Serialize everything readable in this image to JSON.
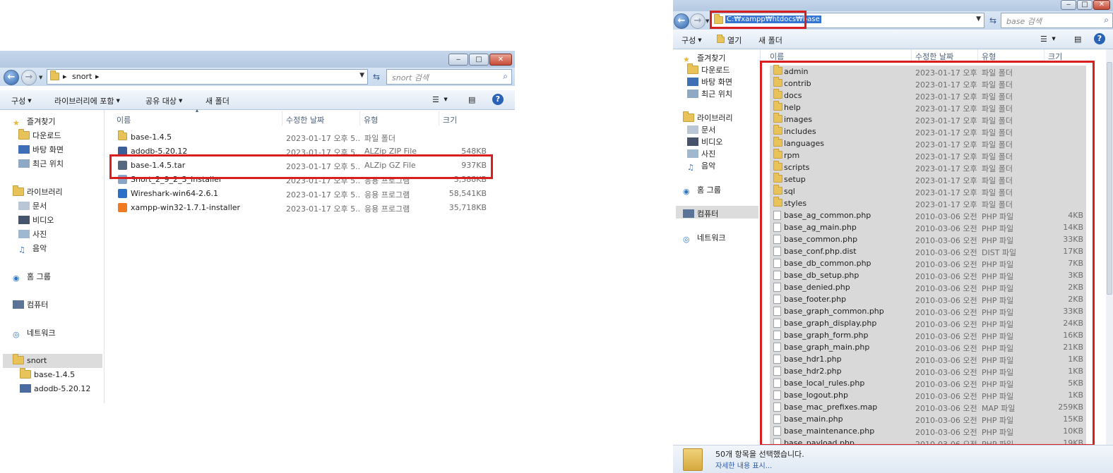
{
  "left": {
    "path": [
      "snort"
    ],
    "search_placeholder": "snort 검색",
    "toolbar": {
      "organize": "구성",
      "include_library": "라이브러리에 포함",
      "share": "공유 대상",
      "new_folder": "새 폴더"
    },
    "columns": {
      "name": "이름",
      "date": "수정한 날짜",
      "type": "유형",
      "size": "크기"
    },
    "nav": {
      "favorites": "즐겨찾기",
      "downloads": "다운로드",
      "desktop": "바탕 화면",
      "recent": "최근 위치",
      "libraries": "라이브러리",
      "documents": "문서",
      "videos": "비디오",
      "pictures": "사진",
      "music": "음악",
      "homegroup": "홈 그룹",
      "computer": "컴퓨터",
      "network": "네트워크",
      "snort": "snort",
      "base": "base-1.4.5",
      "adodb": "adodb-5.20.12"
    },
    "files": [
      {
        "name": "base-1.4.5",
        "date": "2023-01-17 오후 5...",
        "type": "파일 폴더",
        "size": "",
        "icon": "folder"
      },
      {
        "name": "adodb-5.20.12",
        "date": "2023-01-17 오후 5...",
        "type": "ALZip ZIP File",
        "size": "548KB",
        "icon": "zip"
      },
      {
        "name": "base-1.4.5.tar",
        "date": "2023-01-17 오후 5...",
        "type": "ALZip GZ File",
        "size": "937KB",
        "icon": "gz"
      },
      {
        "name": "Snort_2_9_2_3_Installer",
        "date": "2023-01-17 오후 5...",
        "type": "응용 프로그램",
        "size": "3,388KB",
        "icon": "app"
      },
      {
        "name": "Wireshark-win64-2.6.1",
        "date": "2023-01-17 오후 5...",
        "type": "응용 프로그램",
        "size": "58,541KB",
        "icon": "shark"
      },
      {
        "name": "xampp-win32-1.7.1-installer",
        "date": "2023-01-17 오후 5...",
        "type": "응용 프로그램",
        "size": "35,718KB",
        "icon": "xampp"
      }
    ]
  },
  "right": {
    "path": "C:₩xampp₩htdocs₩base",
    "search_placeholder": "base 검색",
    "toolbar": {
      "organize": "구성",
      "open": "열기",
      "new_folder": "새 폴더"
    },
    "columns": {
      "name": "이름",
      "date": "수정한 날짜",
      "type": "유형",
      "size": "크기"
    },
    "nav": {
      "favorites": "즐겨찾기",
      "downloads": "다운로드",
      "desktop": "바탕 화면",
      "recent": "최근 위치",
      "libraries": "라이브러리",
      "documents": "문서",
      "videos": "비디오",
      "pictures": "사진",
      "music": "음악",
      "homegroup": "홈 그룹",
      "computer": "컴퓨터",
      "network": "네트워크"
    },
    "files": [
      {
        "name": "admin",
        "date": "2023-01-17 오후 5...",
        "type": "파일 폴더",
        "size": "",
        "icon": "folder"
      },
      {
        "name": "contrib",
        "date": "2023-01-17 오후 5...",
        "type": "파일 폴더",
        "size": "",
        "icon": "folder"
      },
      {
        "name": "docs",
        "date": "2023-01-17 오후 5...",
        "type": "파일 폴더",
        "size": "",
        "icon": "folder"
      },
      {
        "name": "help",
        "date": "2023-01-17 오후 5...",
        "type": "파일 폴더",
        "size": "",
        "icon": "folder"
      },
      {
        "name": "images",
        "date": "2023-01-17 오후 5...",
        "type": "파일 폴더",
        "size": "",
        "icon": "folder"
      },
      {
        "name": "includes",
        "date": "2023-01-17 오후 5...",
        "type": "파일 폴더",
        "size": "",
        "icon": "folder"
      },
      {
        "name": "languages",
        "date": "2023-01-17 오후 5...",
        "type": "파일 폴더",
        "size": "",
        "icon": "folder"
      },
      {
        "name": "rpm",
        "date": "2023-01-17 오후 5...",
        "type": "파일 폴더",
        "size": "",
        "icon": "folder"
      },
      {
        "name": "scripts",
        "date": "2023-01-17 오후 5...",
        "type": "파일 폴더",
        "size": "",
        "icon": "folder"
      },
      {
        "name": "setup",
        "date": "2023-01-17 오후 5...",
        "type": "파일 폴더",
        "size": "",
        "icon": "folder"
      },
      {
        "name": "sql",
        "date": "2023-01-17 오후 5...",
        "type": "파일 폴더",
        "size": "",
        "icon": "folder"
      },
      {
        "name": "styles",
        "date": "2023-01-17 오후 5...",
        "type": "파일 폴더",
        "size": "",
        "icon": "folder"
      },
      {
        "name": "base_ag_common.php",
        "date": "2010-03-06 오전 1...",
        "type": "PHP 파일",
        "size": "4KB",
        "icon": "file"
      },
      {
        "name": "base_ag_main.php",
        "date": "2010-03-06 오전 1...",
        "type": "PHP 파일",
        "size": "14KB",
        "icon": "file"
      },
      {
        "name": "base_common.php",
        "date": "2010-03-06 오전 1...",
        "type": "PHP 파일",
        "size": "33KB",
        "icon": "file"
      },
      {
        "name": "base_conf.php.dist",
        "date": "2010-03-06 오전 1...",
        "type": "DIST 파일",
        "size": "17KB",
        "icon": "file"
      },
      {
        "name": "base_db_common.php",
        "date": "2010-03-06 오전 1...",
        "type": "PHP 파일",
        "size": "7KB",
        "icon": "file"
      },
      {
        "name": "base_db_setup.php",
        "date": "2010-03-06 오전 1...",
        "type": "PHP 파일",
        "size": "3KB",
        "icon": "file"
      },
      {
        "name": "base_denied.php",
        "date": "2010-03-06 오전 1...",
        "type": "PHP 파일",
        "size": "2KB",
        "icon": "file"
      },
      {
        "name": "base_footer.php",
        "date": "2010-03-06 오전 1...",
        "type": "PHP 파일",
        "size": "2KB",
        "icon": "file"
      },
      {
        "name": "base_graph_common.php",
        "date": "2010-03-06 오전 1...",
        "type": "PHP 파일",
        "size": "33KB",
        "icon": "file"
      },
      {
        "name": "base_graph_display.php",
        "date": "2010-03-06 오전 1...",
        "type": "PHP 파일",
        "size": "24KB",
        "icon": "file"
      },
      {
        "name": "base_graph_form.php",
        "date": "2010-03-06 오전 1...",
        "type": "PHP 파일",
        "size": "16KB",
        "icon": "file"
      },
      {
        "name": "base_graph_main.php",
        "date": "2010-03-06 오전 1...",
        "type": "PHP 파일",
        "size": "21KB",
        "icon": "file"
      },
      {
        "name": "base_hdr1.php",
        "date": "2010-03-06 오전 1...",
        "type": "PHP 파일",
        "size": "1KB",
        "icon": "file"
      },
      {
        "name": "base_hdr2.php",
        "date": "2010-03-06 오전 1...",
        "type": "PHP 파일",
        "size": "1KB",
        "icon": "file"
      },
      {
        "name": "base_local_rules.php",
        "date": "2010-03-06 오전 1...",
        "type": "PHP 파일",
        "size": "5KB",
        "icon": "file"
      },
      {
        "name": "base_logout.php",
        "date": "2010-03-06 오전 1...",
        "type": "PHP 파일",
        "size": "1KB",
        "icon": "file"
      },
      {
        "name": "base_mac_prefixes.map",
        "date": "2010-03-06 오전 1...",
        "type": "MAP 파일",
        "size": "259KB",
        "icon": "file"
      },
      {
        "name": "base_main.php",
        "date": "2010-03-06 오전 1...",
        "type": "PHP 파일",
        "size": "15KB",
        "icon": "file"
      },
      {
        "name": "base_maintenance.php",
        "date": "2010-03-06 오전 1...",
        "type": "PHP 파일",
        "size": "10KB",
        "icon": "file"
      },
      {
        "name": "base_payload.php",
        "date": "2010-03-06 오전 1...",
        "type": "PHP 파일",
        "size": "19KB",
        "icon": "file"
      }
    ],
    "status": {
      "selected": "50개 항목을 선택했습니다.",
      "details": "자세한 내용 표시..."
    }
  },
  "colors": {
    "highlight": "#d81e1e",
    "selection": "#d9d9d9"
  }
}
